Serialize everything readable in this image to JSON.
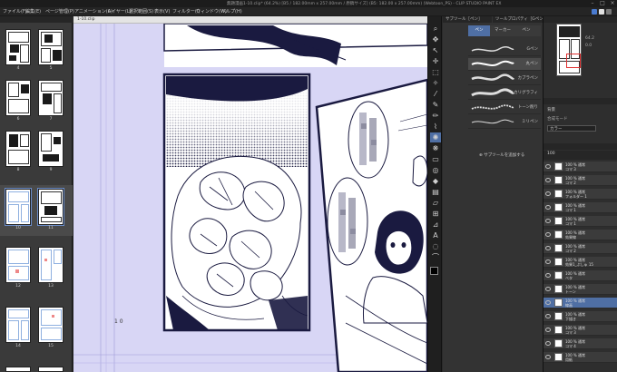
{
  "window": {
    "title": "無題漫画1-10.clip* (64.2%) [B5 / 182.00mm x 257.00mm / 原稿サイズ] (B5: 182.00 x 257.00mm) (Webtoon_PS) - CLIP STUDIO PAINT EX"
  },
  "menu": {
    "items": [
      "ファイル(F)",
      "編集(E)",
      "ページ管理(P)",
      "アニメーション(A)",
      "レイヤー(L)",
      "選択範囲(S)",
      "表示(V)",
      "フィルター(I)",
      "ウィンドウ(W)",
      "ヘルプ(H)"
    ]
  },
  "page_panel": {
    "page_numbers": [
      "4",
      "5",
      "6",
      "7",
      "8",
      "9",
      "10",
      "11",
      "12",
      "13",
      "14",
      "15",
      "16",
      "17"
    ]
  },
  "canvas": {
    "tab_label": "1-10.clip",
    "page_marker": "1 0"
  },
  "subtool": {
    "header_tabs": [
      "サブツール［ペン］",
      "ツールプロパティ［Gペン］"
    ],
    "tab_labels": [
      "ペン",
      "マーカー",
      "ペン"
    ],
    "brushes": [
      "Gペン",
      "丸ペン",
      "カブラペン",
      "カリグラフィ",
      "トーン削り",
      "ミリペン"
    ],
    "add_button": "サブツールを追加する"
  },
  "navigator": {
    "zoom": "64.2",
    "angle": "0.0"
  },
  "properties": {
    "layer_name": "背景",
    "blend_label": "合成モード",
    "opacity": "100",
    "color_label": "カラー"
  },
  "layers": [
    {
      "name": "100 % 通常",
      "sub": "コマ 3",
      "sel": false
    },
    {
      "name": "100 % 通常",
      "sub": "コマ 2",
      "sel": false
    },
    {
      "name": "100 % 通常",
      "sub": "フォルダー 1",
      "sel": false
    },
    {
      "name": "100 % 通常",
      "sub": "コマ 1",
      "sel": false
    },
    {
      "name": "100 % 通常",
      "sub": "コマ 1",
      "sel": false
    },
    {
      "name": "100 % 通常",
      "sub": "効果線",
      "sel": false
    },
    {
      "name": "100 % 通常",
      "sub": "コマ 2",
      "sel": false
    },
    {
      "name": "100 % 通常",
      "sub": "効果1_ぷしゅ 15",
      "sel": false
    },
    {
      "name": "100 % 通常",
      "sub": "ベタ",
      "sel": false
    },
    {
      "name": "100 % 通常",
      "sub": "トーン",
      "sel": false
    },
    {
      "name": "100 % 通常",
      "sub": "線画",
      "sel": true
    },
    {
      "name": "100 % 通常",
      "sub": "下描き",
      "sel": false
    },
    {
      "name": "100 % 通常",
      "sub": "コマ 3",
      "sel": false
    },
    {
      "name": "100 % 通常",
      "sub": "コマ 4",
      "sel": false
    },
    {
      "name": "100 % 通常",
      "sub": "用紙",
      "sel": false
    }
  ],
  "colors": {
    "canvas_bg": "#d8d6f5",
    "ui_dark": "#2b2b2b",
    "selection": "#4f6fa4",
    "ink": "#1a1a40"
  }
}
